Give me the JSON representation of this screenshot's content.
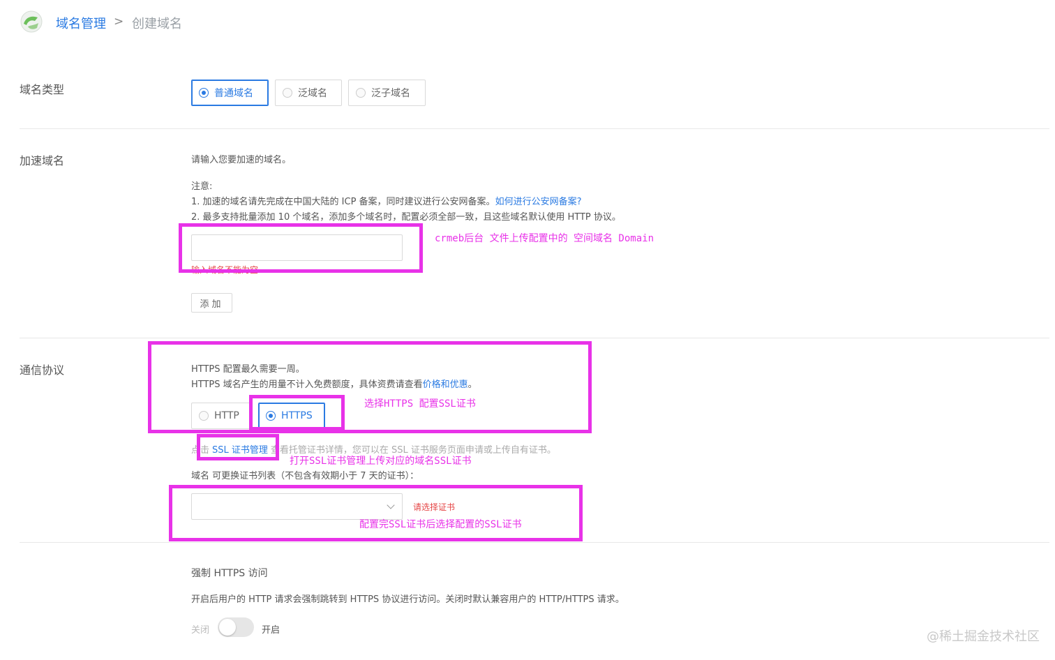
{
  "breadcrumb": {
    "home": "域名管理",
    "separator": ">",
    "current": "创建域名"
  },
  "domain_type": {
    "label": "域名类型",
    "options": [
      "普通域名",
      "泛域名",
      "泛子域名"
    ],
    "selected": "普通域名"
  },
  "accelerate_domain": {
    "label": "加速域名",
    "intro": "请输入您要加速的域名。",
    "note_title": "注意:",
    "note_1": "1. 加速的域名请先完成在中国大陆的 ICP 备案，同时建议进行公安网备案。",
    "note_1_link": "如何进行公安网备案?",
    "note_2": "2. 最多支持批量添加 10 个域名，添加多个域名时，配置必须全部一致，且这些域名默认使用 HTTP 协议。",
    "input_value": "",
    "error": "输入域名不能为空",
    "add_button": "添加"
  },
  "protocol": {
    "label": "通信协议",
    "line_1": "HTTPS 配置最久需要一周。",
    "line_2_prefix": "HTTPS 域名产生的用量不计入免费额度，具体资费请查看",
    "line_2_link": "价格和优惠",
    "line_2_suffix": "。",
    "options": [
      "HTTP",
      "HTTPS"
    ],
    "selected": "HTTPS",
    "ssl_prefix": "点击",
    "ssl_link": "SSL 证书管理",
    "ssl_suffix": "查看托管证书详情，您可以在 SSL 证书服务页面申请或上传自有证书。",
    "cert_list_label": "域名 可更换证书列表（不包含有效期小于 7 天的证书）：",
    "cert_select_value": "",
    "cert_error": "请选择证书"
  },
  "force_https": {
    "title": "强制 HTTPS 访问",
    "desc": "开启后用户的 HTTP 请求会强制跳转到 HTTPS 协议进行访问。关闭时默认兼容用户的 HTTP/HTTPS 请求。",
    "off_label": "关闭",
    "on_label": "开启"
  },
  "annotations": {
    "domain_note": "crmeb后台 文件上传配置中的 空间域名 Domain",
    "https_note": "选择HTTPS  配置SSL证书",
    "ssl_note": "打开SSL证书管理上传对应的域名SSL证书",
    "cert_note": "配置完SSL证书后选择配置的SSL证书"
  },
  "watermark": "@稀土掘金技术社区",
  "colors": {
    "primary": "#2a7ae2",
    "annotation": "#e832e8",
    "error": "#e54545"
  }
}
